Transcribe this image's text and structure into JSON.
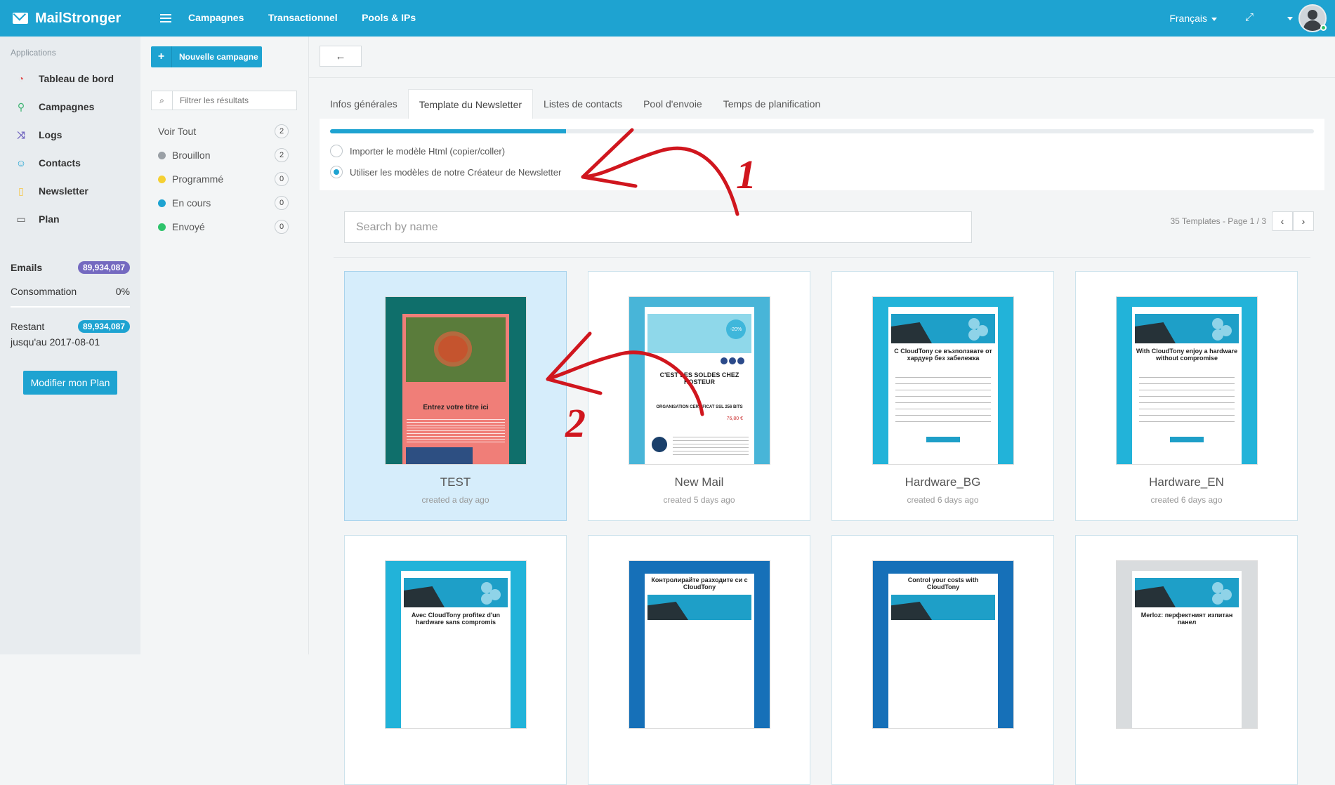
{
  "brand": {
    "name": "MailStronger"
  },
  "topnav": {
    "items": [
      "Campagnes",
      "Transactionnel",
      "Pools & IPs"
    ],
    "language": "Français"
  },
  "sidebar": {
    "heading": "Applications",
    "items": [
      {
        "label": "Tableau de bord",
        "icon": "dashboard-icon",
        "color": "#e05252"
      },
      {
        "label": "Campagnes",
        "icon": "campaign-icon",
        "color": "#3cb371"
      },
      {
        "label": "Logs",
        "icon": "logs-icon",
        "color": "#7469c0"
      },
      {
        "label": "Contacts",
        "icon": "contacts-icon",
        "color": "#1ea3d1"
      },
      {
        "label": "Newsletter",
        "icon": "newsletter-icon",
        "color": "#f5c542"
      },
      {
        "label": "Plan",
        "icon": "plan-icon",
        "color": "#555555"
      }
    ],
    "stats": {
      "emails_label": "Emails",
      "emails_value": "89,934,087",
      "consumption_label": "Consommation",
      "consumption_value": "0%",
      "remaining_label": "Restant",
      "remaining_value": "89,934,087",
      "until_label": "jusqu'au 2017-08-01"
    },
    "plan_button": "Modifier mon Plan"
  },
  "filters": {
    "new_button": "Nouvelle campagne",
    "search_placeholder": "Filtrer les résultats",
    "statuses": [
      {
        "label": "Voir Tout",
        "count": "2",
        "color": ""
      },
      {
        "label": "Brouillon",
        "count": "2",
        "color": "#9aa0a6"
      },
      {
        "label": "Programmé",
        "count": "0",
        "color": "#f5d033"
      },
      {
        "label": "En cours",
        "count": "0",
        "color": "#1ea3d1"
      },
      {
        "label": "Envoyé",
        "count": "0",
        "color": "#2ec36b"
      }
    ]
  },
  "main": {
    "back_button": "←",
    "tabs": [
      "Infos générales",
      "Template du Newsletter",
      "Listes de contacts",
      "Pool d'envoie",
      "Temps de planification"
    ],
    "active_tab": "Template du Newsletter",
    "progress_percent": 24,
    "options": [
      {
        "label": "Importer le modèle Html (copier/coller)",
        "selected": false
      },
      {
        "label": "Utiliser les modèles de notre Créateur de Newsletter",
        "selected": true
      }
    ],
    "search_placeholder": "Search by name",
    "pager_text": "35 Templates - Page 1 / 3",
    "templates": [
      {
        "name": "TEST",
        "date": "created a day ago",
        "selected": true,
        "style": "test",
        "thumb_title": "Entrez votre titre ici"
      },
      {
        "name": "New Mail",
        "date": "created 5 days ago",
        "selected": false,
        "style": "sale",
        "thumb_title": "C'EST LES SOLDES CHEZ HOSTEUR",
        "thumb_sub": "ORGANISATION CERTIFICAT SSL 256 BITS",
        "thumb_price": "76,80 €"
      },
      {
        "name": "Hardware_BG",
        "date": "created 6 days ago",
        "selected": false,
        "style": "blue",
        "thumb_title": "С CloudTony се възползвате от хардуер без забележка"
      },
      {
        "name": "Hardware_EN",
        "date": "created 6 days ago",
        "selected": false,
        "style": "blue",
        "thumb_title": "With CloudTony enjoy a hardware without compromise"
      },
      {
        "name": "",
        "date": "",
        "selected": false,
        "style": "blue",
        "thumb_title": "Avec CloudTony profitez d'un hardware sans compromis"
      },
      {
        "name": "",
        "date": "",
        "selected": false,
        "style": "dark",
        "thumb_title": "Контролирайте разходите си с CloudTony"
      },
      {
        "name": "",
        "date": "",
        "selected": false,
        "style": "dark",
        "thumb_title": "Control your costs with CloudTony"
      },
      {
        "name": "",
        "date": "",
        "selected": false,
        "style": "gray",
        "thumb_title": "Merloz: перфектният изпитан панел"
      }
    ]
  },
  "annotations": {
    "label1": "1",
    "label2": "2",
    "color": "#d0161e"
  }
}
